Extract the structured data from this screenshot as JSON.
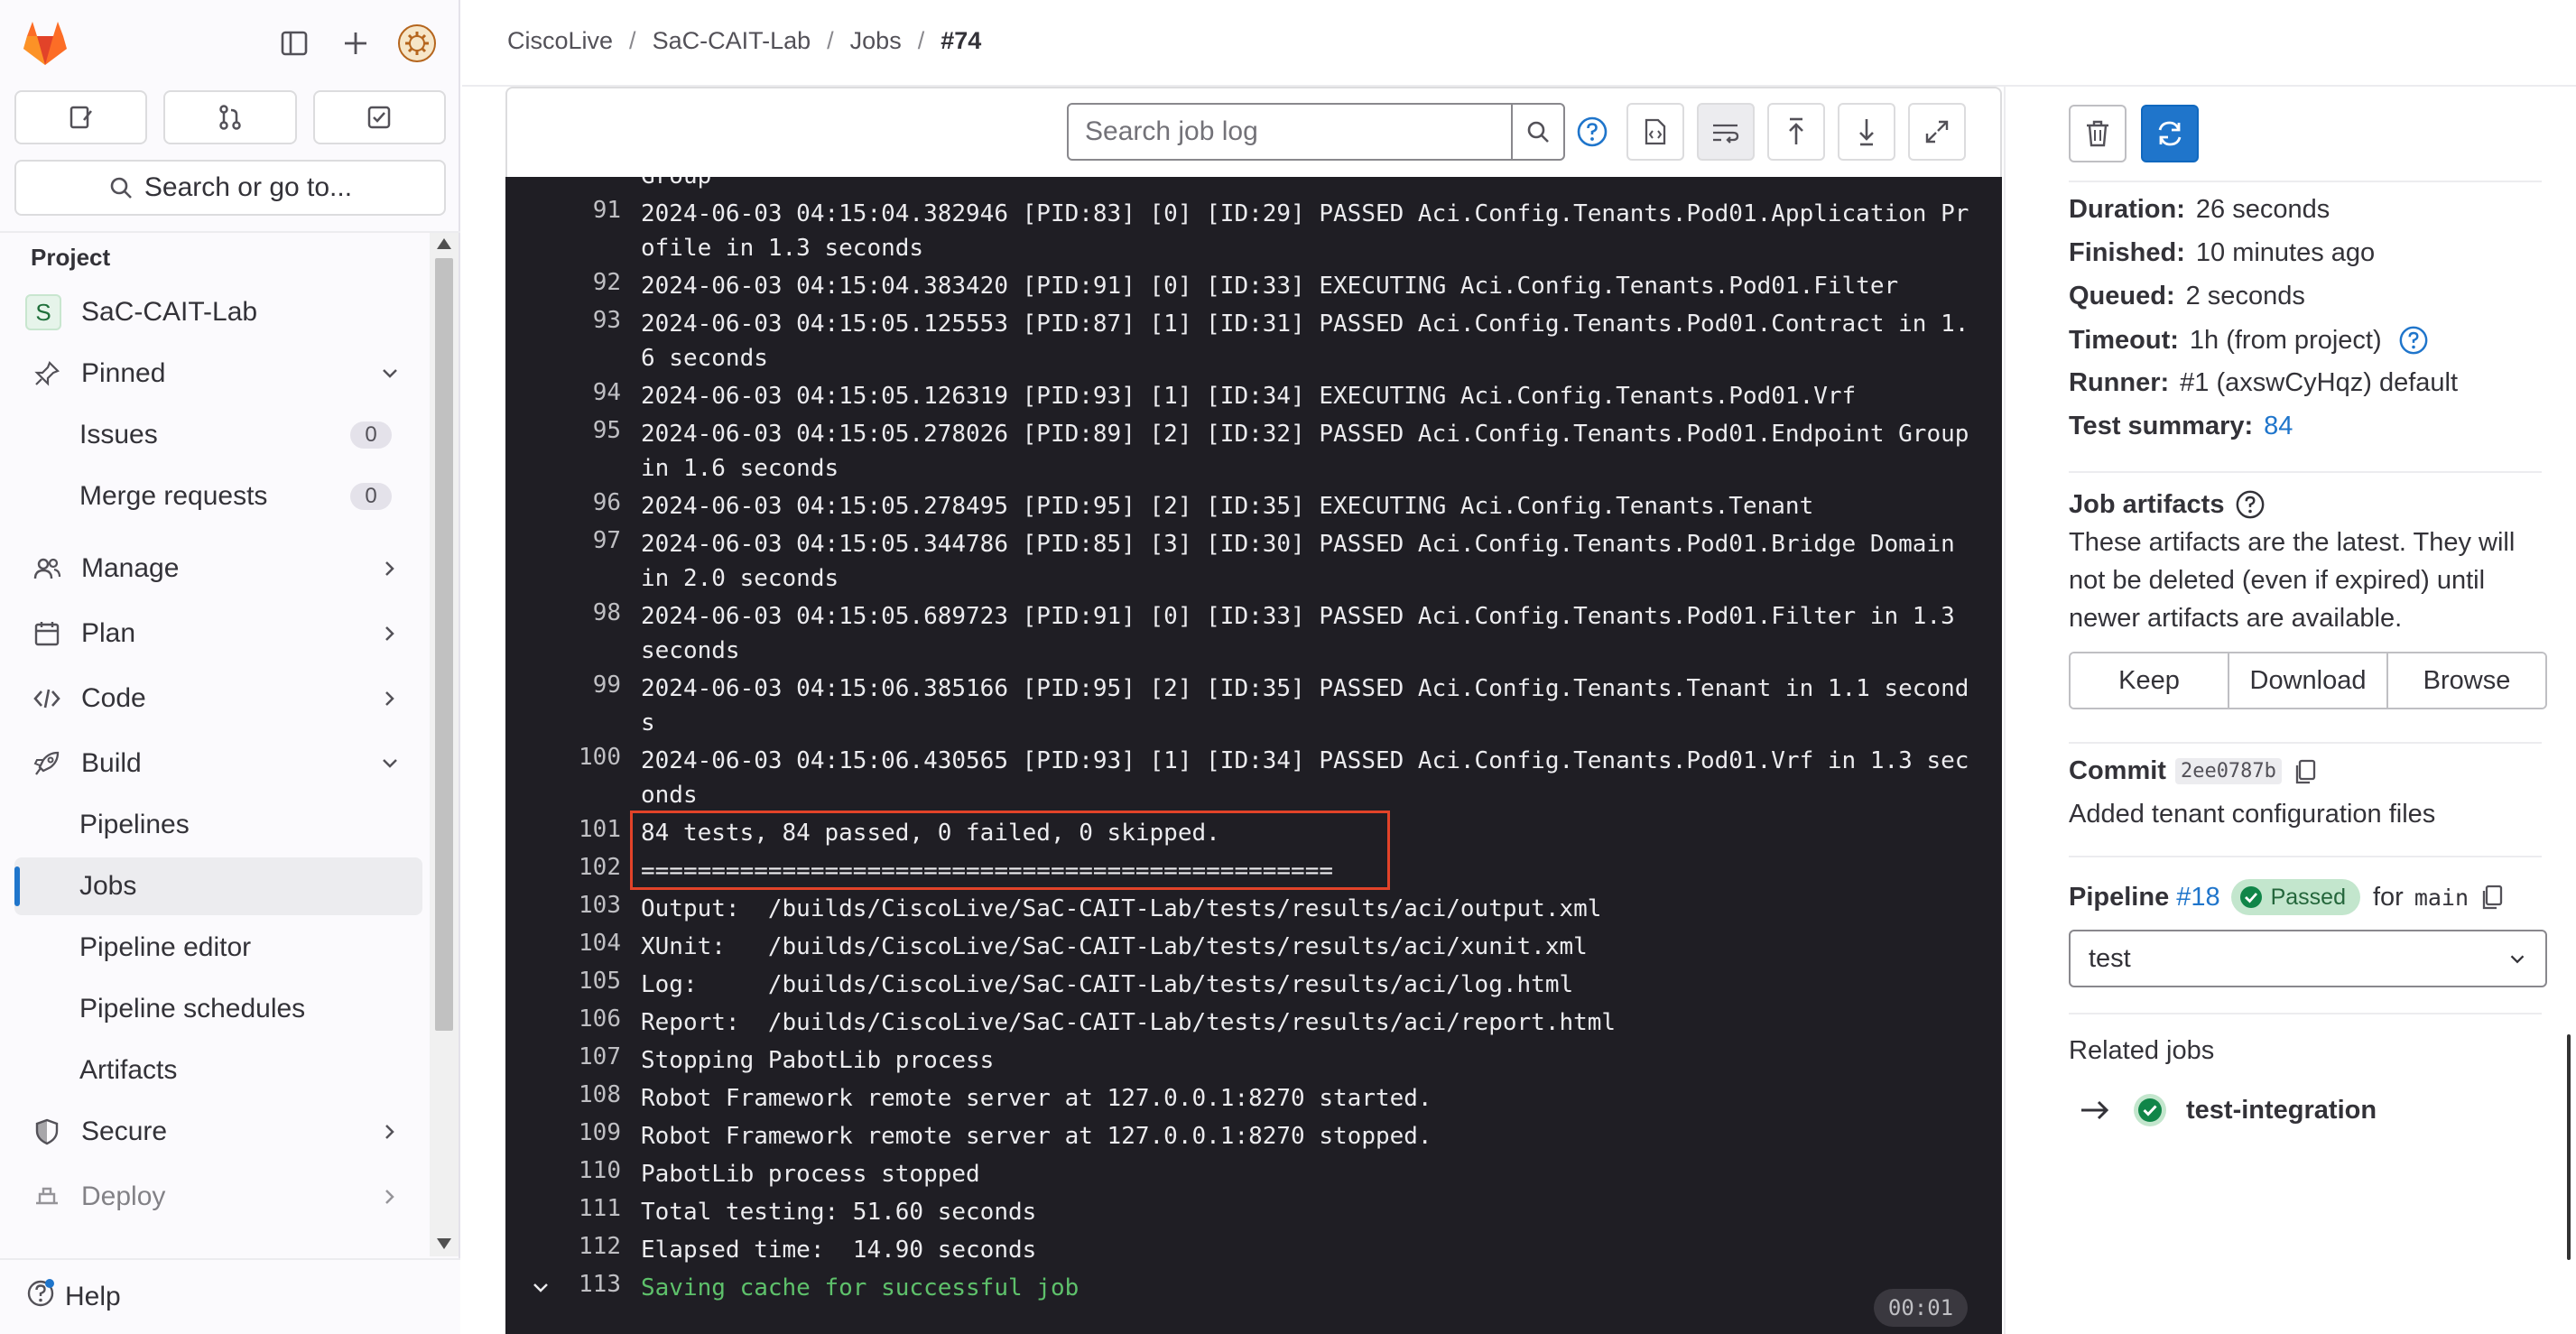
{
  "sidebar": {
    "search_label": "Search or go to...",
    "section_title": "Project",
    "project": {
      "avatar_letter": "S",
      "name": "SaC-CAIT-Lab"
    },
    "pinned": {
      "label": "Pinned",
      "items": [
        {
          "label": "Issues",
          "count": "0"
        },
        {
          "label": "Merge requests",
          "count": "0"
        }
      ]
    },
    "groups": [
      {
        "label": "Manage",
        "icon": "users-icon"
      },
      {
        "label": "Plan",
        "icon": "calendar-icon"
      },
      {
        "label": "Code",
        "icon": "code-icon"
      },
      {
        "label": "Build",
        "icon": "rocket-icon"
      }
    ],
    "build_items": [
      "Pipelines",
      "Jobs",
      "Pipeline editor",
      "Pipeline schedules",
      "Artifacts"
    ],
    "active_item": "Jobs",
    "more_groups": [
      {
        "label": "Secure",
        "icon": "shield-icon"
      },
      {
        "label": "Deploy",
        "icon": "deploy-icon"
      }
    ],
    "help_label": "Help"
  },
  "breadcrumb": [
    "CiscoLive",
    "SaC-CAIT-Lab",
    "Jobs",
    "#74"
  ],
  "log": {
    "search_placeholder": "Search job log",
    "lines": [
      {
        "n": "",
        "text": "Group"
      },
      {
        "n": "91",
        "text": "2024-06-03 04:15:04.382946 [PID:83] [0] [ID:29] PASSED Aci.Config.Tenants.Pod01.Application Profile in 1.3 seconds"
      },
      {
        "n": "92",
        "text": "2024-06-03 04:15:04.383420 [PID:91] [0] [ID:33] EXECUTING Aci.Config.Tenants.Pod01.Filter"
      },
      {
        "n": "93",
        "text": "2024-06-03 04:15:05.125553 [PID:87] [1] [ID:31] PASSED Aci.Config.Tenants.Pod01.Contract in 1.6 seconds"
      },
      {
        "n": "94",
        "text": "2024-06-03 04:15:05.126319 [PID:93] [1] [ID:34] EXECUTING Aci.Config.Tenants.Pod01.Vrf"
      },
      {
        "n": "95",
        "text": "2024-06-03 04:15:05.278026 [PID:89] [2] [ID:32] PASSED Aci.Config.Tenants.Pod01.Endpoint Group in 1.6 seconds"
      },
      {
        "n": "96",
        "text": "2024-06-03 04:15:05.278495 [PID:95] [2] [ID:35] EXECUTING Aci.Config.Tenants.Tenant"
      },
      {
        "n": "97",
        "text": "2024-06-03 04:15:05.344786 [PID:85] [3] [ID:30] PASSED Aci.Config.Tenants.Pod01.Bridge Domain in 2.0 seconds"
      },
      {
        "n": "98",
        "text": "2024-06-03 04:15:05.689723 [PID:91] [0] [ID:33] PASSED Aci.Config.Tenants.Pod01.Filter in 1.3 seconds"
      },
      {
        "n": "99",
        "text": "2024-06-03 04:15:06.385166 [PID:95] [2] [ID:35] PASSED Aci.Config.Tenants.Tenant in 1.1 seconds"
      },
      {
        "n": "100",
        "text": "2024-06-03 04:15:06.430565 [PID:93] [1] [ID:34] PASSED Aci.Config.Tenants.Pod01.Vrf in 1.3 seconds"
      },
      {
        "n": "101",
        "text": "84 tests, 84 passed, 0 failed, 0 skipped."
      },
      {
        "n": "102",
        "text": "================================================="
      },
      {
        "n": "103",
        "text": "Output:  /builds/CiscoLive/SaC-CAIT-Lab/tests/results/aci/output.xml"
      },
      {
        "n": "104",
        "text": "XUnit:   /builds/CiscoLive/SaC-CAIT-Lab/tests/results/aci/xunit.xml"
      },
      {
        "n": "105",
        "text": "Log:     /builds/CiscoLive/SaC-CAIT-Lab/tests/results/aci/log.html"
      },
      {
        "n": "106",
        "text": "Report:  /builds/CiscoLive/SaC-CAIT-Lab/tests/results/aci/report.html"
      },
      {
        "n": "107",
        "text": "Stopping PabotLib process"
      },
      {
        "n": "108",
        "text": "Robot Framework remote server at 127.0.0.1:8270 started."
      },
      {
        "n": "109",
        "text": "Robot Framework remote server at 127.0.0.1:8270 stopped."
      },
      {
        "n": "110",
        "text": "PabotLib process stopped"
      },
      {
        "n": "111",
        "text": "Total testing: 51.60 seconds"
      },
      {
        "n": "112",
        "text": "Elapsed time:  14.90 seconds"
      },
      {
        "n": "113",
        "text": "Saving cache for successful job",
        "color": "#5ec16b"
      }
    ],
    "elapsed_badge": "00:01"
  },
  "job": {
    "duration_label": "Duration:",
    "duration": "26 seconds",
    "finished_label": "Finished:",
    "finished": "10 minutes ago",
    "queued_label": "Queued:",
    "queued": "2 seconds",
    "timeout_label": "Timeout:",
    "timeout": "1h (from project)",
    "runner_label": "Runner:",
    "runner": "#1 (axswCyHqz) default",
    "test_summary_label": "Test summary:",
    "test_summary": "84"
  },
  "artifacts": {
    "title": "Job artifacts",
    "description": "These artifacts are the latest. They will not be deleted (even if expired) until newer artifacts are available.",
    "buttons": [
      "Keep",
      "Download",
      "Browse"
    ]
  },
  "commit": {
    "label": "Commit",
    "sha": "2ee0787b",
    "message": "Added tenant configuration files"
  },
  "pipeline": {
    "label": "Pipeline",
    "id": "#18",
    "status": "Passed",
    "for_label": "for",
    "ref": "main",
    "stage": "test"
  },
  "related_jobs": {
    "title": "Related jobs",
    "items": [
      "test-integration"
    ]
  },
  "colors": {
    "accent": "#1f75cb",
    "success": "#108548",
    "highlight": "#e24329",
    "log_bg": "#1f1e24"
  }
}
